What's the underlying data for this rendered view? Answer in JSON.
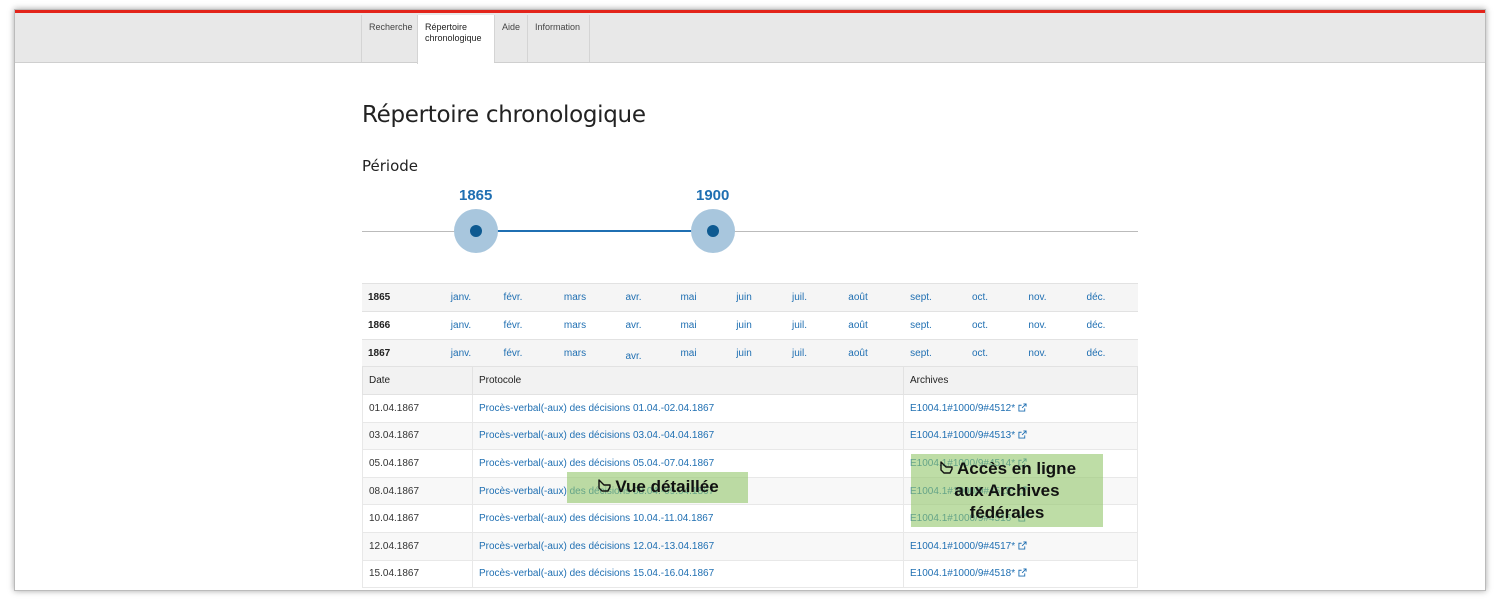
{
  "nav": {
    "tabs": [
      {
        "label": "Recherche"
      },
      {
        "label": "Répertoire\nchronologique",
        "line1": "Répertoire",
        "line2": "chronologique"
      },
      {
        "label": "Aide"
      },
      {
        "label": "Information"
      }
    ],
    "active_tab": 1
  },
  "page_title": "Répertoire chronologique",
  "period": {
    "label": "Période",
    "start": "1865",
    "end": "1900"
  },
  "months": [
    "janv.",
    "févr.",
    "mars",
    "avr.",
    "mai",
    "juin",
    "juil.",
    "août",
    "sept.",
    "oct.",
    "nov.",
    "déc."
  ],
  "years": [
    "1865",
    "1866",
    "1867"
  ],
  "selected": {
    "year": "1867",
    "month": "avr."
  },
  "table": {
    "headers": {
      "date": "Date",
      "protocol": "Protocole",
      "archives": "Archives"
    },
    "rows": [
      {
        "date": "01.04.1867",
        "protocol": "Procès-verbal(-aux) des décisions 01.04.-02.04.1867",
        "archive": "E1004.1#1000/9#4512*"
      },
      {
        "date": "03.04.1867",
        "protocol": "Procès-verbal(-aux) des décisions 03.04.-04.04.1867",
        "archive": "E1004.1#1000/9#4513*"
      },
      {
        "date": "05.04.1867",
        "protocol": "Procès-verbal(-aux) des décisions 05.04.-07.04.1867",
        "archive": "E1004.1#1000/9#4514*"
      },
      {
        "date": "08.04.1867",
        "protocol": "Procès-verbal(-aux) des décisions 08.04.-09.04.1867",
        "archive": "E1004.1#1000/9#4515*"
      },
      {
        "date": "10.04.1867",
        "protocol": "Procès-verbal(-aux) des décisions 10.04.-11.04.1867",
        "archive": "E1004.1#1000/9#4516*"
      },
      {
        "date": "12.04.1867",
        "protocol": "Procès-verbal(-aux) des décisions 12.04.-13.04.1867",
        "archive": "E1004.1#1000/9#4517*"
      },
      {
        "date": "15.04.1867",
        "protocol": "Procès-verbal(-aux) des décisions 15.04.-16.04.1867",
        "archive": "E1004.1#1000/9#4518*"
      }
    ]
  },
  "callouts": {
    "detail_view": "Vue détaillée",
    "archives_line1": "Accès en ligne",
    "archives_line2": "aux Archives",
    "archives_line3": "fédérales"
  },
  "colors": {
    "accent_red": "#e3241b",
    "link_blue": "#1f6fb2",
    "callout_green": "#92c66a"
  }
}
